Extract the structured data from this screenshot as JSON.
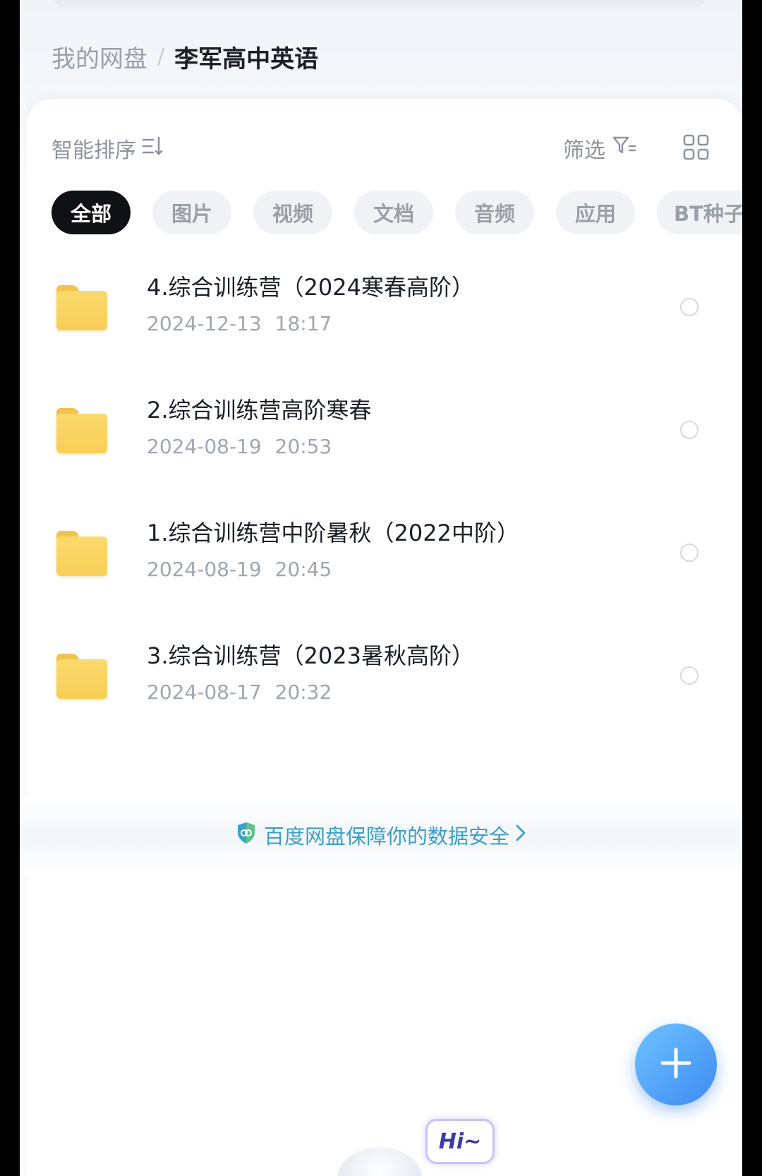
{
  "breadcrumb": {
    "root": "我的网盘",
    "separator": "/",
    "current": "李军高中英语"
  },
  "toolbar": {
    "sort_label": "智能排序",
    "sort_icon": "sort-lines-icon",
    "filter_label": "筛选",
    "filter_icon": "filter-funnel-icon",
    "view_toggle_icon": "grid-view-icon"
  },
  "filters": {
    "chips": [
      "全部",
      "图片",
      "视频",
      "文档",
      "音频",
      "应用",
      "BT种子"
    ],
    "active": "全部"
  },
  "files": [
    {
      "name": "4.综合训练营（2024寒春高阶）",
      "date": "2024-12-13 18:17",
      "type": "folder"
    },
    {
      "name": "2.综合训练营高阶寒春",
      "date": "2024-08-19 20:53",
      "type": "folder"
    },
    {
      "name": "1.综合训练营中阶暑秋（2022中阶）",
      "date": "2024-08-19 20:45",
      "type": "folder"
    },
    {
      "name": "3.综合训练营（2023暑秋高阶）",
      "date": "2024-08-17 20:32",
      "type": "folder"
    }
  ],
  "security_notice": {
    "text": "百度网盘保障你的数据安全",
    "icon": "shield-icon"
  },
  "fab": {
    "icon": "plus-icon"
  },
  "mascot": {
    "bubble_text": "Hi~"
  },
  "colors": {
    "accent_blue": "#3d8bf3",
    "security_text": "#3e9ec8",
    "active_chip": "#0f1115",
    "folder_yellow": "#f8cf57"
  }
}
